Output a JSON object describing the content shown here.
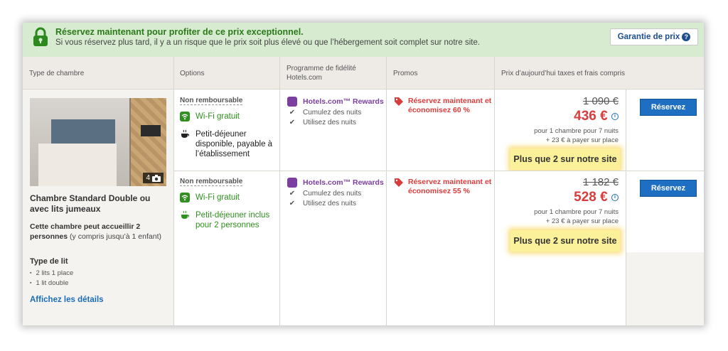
{
  "banner": {
    "title": "Réservez maintenant pour profiter de ce prix exceptionnel.",
    "subtitle": "Si vous réservez plus tard, il y a un risque que le prix soit plus élevé ou que l’hébergement soit complet sur notre site.",
    "guarantee_label": "Garantie de prix",
    "guarantee_icon": "?",
    "lock_color": "#2b8a1b"
  },
  "headers": {
    "room_type": "Type de chambre",
    "options": "Options",
    "loyalty_line1": "Programme de fidélité",
    "loyalty_line2": "Hotels.com",
    "promos": "Promos",
    "price": "Prix d’aujourd’hui taxes et frais compris"
  },
  "room": {
    "photo_count": "4",
    "name": "Chambre Standard Double ou avec lits jumeaux",
    "capacity_bold": "Cette chambre peut accueillir 2 personnes",
    "capacity_rest": " (y compris jusqu’à 1 enfant)",
    "bed_heading": "Type de lit",
    "beds": [
      "2 lits 1 place",
      "1 lit double"
    ],
    "details_link": "Affichez les détails"
  },
  "offers": [
    {
      "policy": "Non remboursable",
      "options": [
        {
          "icon": "wifi-icon",
          "text": "Wi-Fi gratuit",
          "style": "green"
        },
        {
          "icon": "coffee-icon",
          "text": "Petit-déjeuner disponible, payable à l’établissement",
          "style": "dark"
        }
      ],
      "loyalty_brand": "Hotels.com™ Rewards",
      "loyalty_items": [
        "Cumulez des nuits",
        "Utilisez des nuits"
      ],
      "promo": "Réservez maintenant et économisez 60 %",
      "old_price": "1 090 €",
      "new_price": "436 €",
      "per_line1": "pour 1 chambre pour 7 nuits",
      "per_line2": "+ 23 € à payer sur place",
      "scarcity": "Plus que 2 sur notre site",
      "book_label": "Réservez"
    },
    {
      "policy": "Non remboursable",
      "options": [
        {
          "icon": "wifi-icon",
          "text": "Wi-Fi gratuit",
          "style": "green"
        },
        {
          "icon": "coffee-icon",
          "text": "Petit-déjeuner inclus pour 2 personnes",
          "style": "green"
        }
      ],
      "loyalty_brand": "Hotels.com™ Rewards",
      "loyalty_items": [
        "Cumulez des nuits",
        "Utilisez des nuits"
      ],
      "promo": "Réservez maintenant et économisez 55 %",
      "old_price": "1 182 €",
      "new_price": "528 €",
      "per_line1": "pour 1 chambre pour 7 nuits",
      "per_line2": "+ 23 € à payer sur place",
      "scarcity": "Plus que 2 sur notre site",
      "book_label": "Réservez"
    }
  ],
  "colors": {
    "banner_bg": "#d6ebcf",
    "green": "#2f8f1f",
    "promo_red": "#d93c3c",
    "rewards_purple": "#7b3fa0",
    "button_blue": "#1e6ec2",
    "link_blue": "#1a6dbb"
  }
}
